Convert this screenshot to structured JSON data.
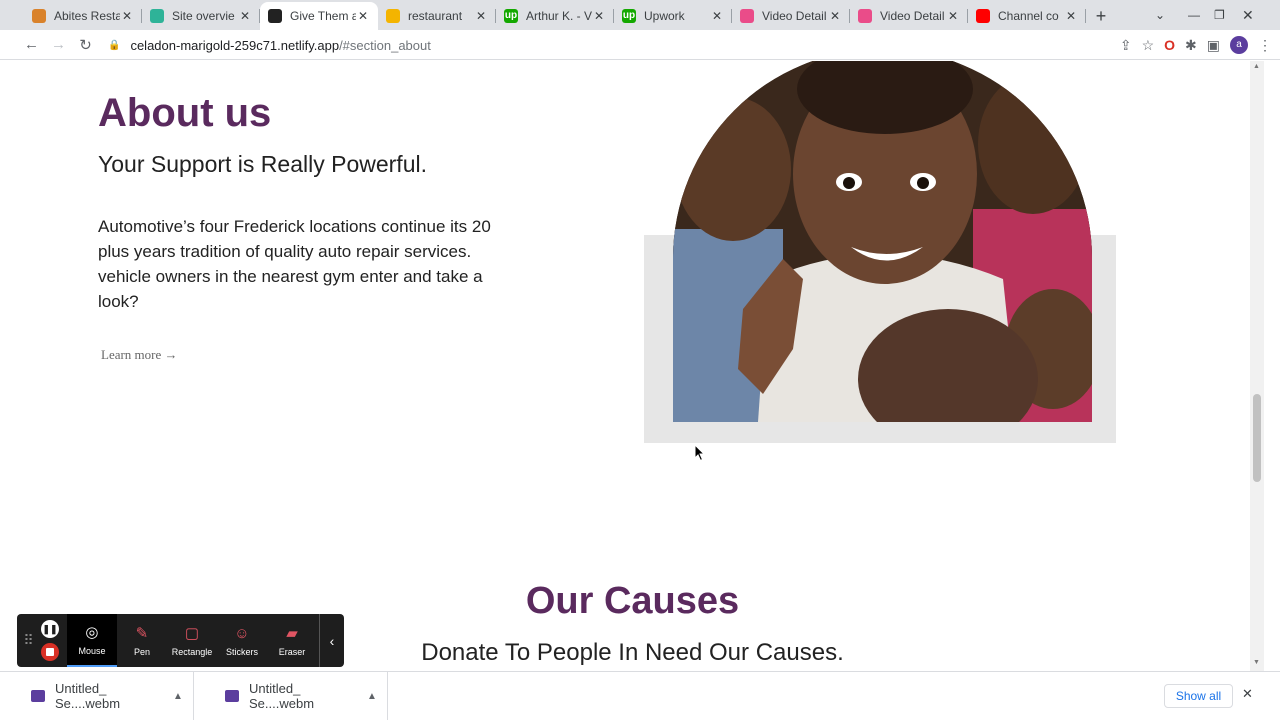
{
  "tabs": [
    {
      "title": "Abites Resta",
      "color": "#d9822b",
      "glyph": "",
      "icon": "burger-favicon"
    },
    {
      "title": "Site overvie",
      "color": "#2eb398",
      "glyph": "",
      "icon": "netlify-favicon"
    },
    {
      "title": "Give Them a",
      "color": "#222222",
      "glyph": "",
      "icon": "site-favicon",
      "active": true
    },
    {
      "title": "restaurant",
      "color": "#f4b400",
      "glyph": "",
      "icon": "drive-favicon"
    },
    {
      "title": "Arthur K. - V",
      "color": "#14a800",
      "glyph": "up",
      "icon": "upwork-favicon"
    },
    {
      "title": "Upwork",
      "color": "#14a800",
      "glyph": "up",
      "icon": "upwork-favicon"
    },
    {
      "title": "Video Detail",
      "color": "#ea4c89",
      "glyph": "",
      "icon": "video-favicon"
    },
    {
      "title": "Video Detail",
      "color": "#ea4c89",
      "glyph": "",
      "icon": "video-favicon"
    },
    {
      "title": "Channel co",
      "color": "#ff0000",
      "glyph": "",
      "icon": "youtube-favicon"
    }
  ],
  "address": {
    "host": "celadon-marigold-259c71.netlify.app",
    "path": "/#section_about"
  },
  "about": {
    "heading": "About us",
    "subheading": "Your Support is Really Powerful.",
    "paragraph": "Automotive’s four Frederick locations continue its 20 plus years tradition of quality auto repair services. vehicle owners in the nearest gym enter and take a look?",
    "link": "Learn more →"
  },
  "causes": {
    "heading": "Our Causes",
    "subheading": "Donate To People In Need Our Causes."
  },
  "recorder": {
    "tools": [
      {
        "label": "Mouse",
        "icon": "mouse-icon",
        "glyph": "◎",
        "selected": true
      },
      {
        "label": "Pen",
        "icon": "pen-icon",
        "glyph": "✎"
      },
      {
        "label": "Rectangle",
        "icon": "rectangle-icon",
        "glyph": "▢"
      },
      {
        "label": "Stickers",
        "icon": "sticker-icon",
        "glyph": "☺"
      },
      {
        "label": "Eraser",
        "icon": "eraser-icon",
        "glyph": "▰"
      }
    ]
  },
  "downloads": {
    "items": [
      "Untitled_ Se....webm",
      "Untitled_ Se....webm"
    ],
    "show_all": "Show all"
  }
}
